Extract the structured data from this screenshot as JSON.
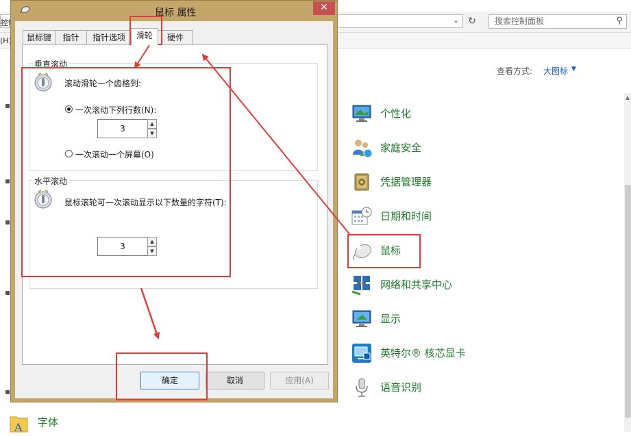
{
  "control_panel": {
    "address_text": "控制",
    "menu_partial": "(H)",
    "search_placeholder": "搜索控制面板",
    "view_by_label": "查看方式:",
    "view_by_value": "大图标",
    "items": [
      {
        "label": "个性化",
        "icon": "personalization-icon"
      },
      {
        "label": "家庭安全",
        "icon": "family-safety-icon"
      },
      {
        "label": "凭据管理器",
        "icon": "credential-manager-icon"
      },
      {
        "label": "日期和时间",
        "icon": "date-time-icon"
      },
      {
        "label": "鼠标",
        "icon": "mouse-icon"
      },
      {
        "label": "网络和共享中心",
        "icon": "network-sharing-icon"
      },
      {
        "label": "显示",
        "icon": "display-icon"
      },
      {
        "label": "英特尔® 核芯显卡",
        "icon": "intel-graphics-icon"
      },
      {
        "label": "语音识别",
        "icon": "speech-recognition-icon"
      }
    ],
    "bottom_left_item": {
      "label": "字体",
      "icon": "fonts-folder-icon"
    }
  },
  "dialog": {
    "title": "鼠标 属性",
    "tabs": [
      "鼠标键",
      "指针",
      "指针选项",
      "滑轮",
      "硬件"
    ],
    "active_tab": "滑轮",
    "vertical": {
      "title": "垂直滚动",
      "description": "滚动滑轮一个齿格到:",
      "option_lines": "一次滚动下列行数(N):",
      "lines_value": "3",
      "option_screen": "一次滚动一个屏幕(O)",
      "selected": "lines"
    },
    "horizontal": {
      "title": "水平滚动",
      "description": "鼠标滚轮可一次滚动显示以下数量的字符(T):",
      "chars_value": "3"
    },
    "buttons": {
      "ok": "确定",
      "cancel": "取消",
      "apply": "应用(A)"
    }
  },
  "colors": {
    "annotation_red": "#e63a3a",
    "item_green": "#1c7b27",
    "link_blue": "#1e5bc6",
    "dialog_frame": "#c4a56a",
    "close_red": "#c75050"
  }
}
